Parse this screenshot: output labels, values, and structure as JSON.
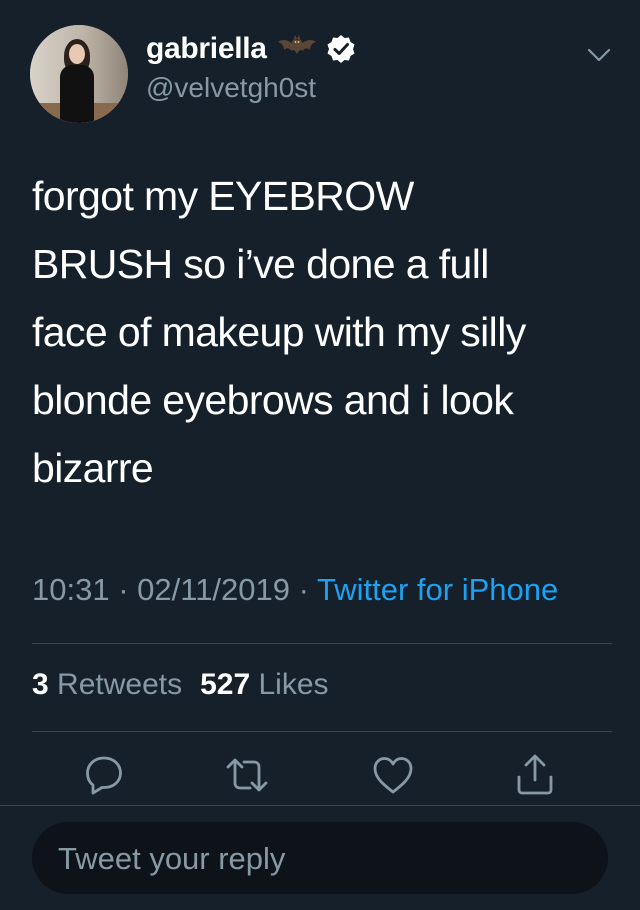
{
  "user": {
    "display_name": "gabriella",
    "handle": "@velvetgh0st",
    "name_emoji": "bat-icon",
    "verified": true
  },
  "tweet": {
    "text": "forgot my EYEBROW\nBRUSH so i’ve done a full\nface of makeup with my silly\nblonde eyebrows and i look\nbizarre",
    "time": "10:31",
    "date": "02/11/2019",
    "separator": "·",
    "source": "Twitter for iPhone"
  },
  "stats": {
    "retweets_count": "3",
    "retweets_label": "Retweets",
    "likes_count": "527",
    "likes_label": "Likes"
  },
  "actions": [
    "reply-icon",
    "retweet-icon",
    "like-icon",
    "share-icon"
  ],
  "reply": {
    "placeholder": "Tweet your reply"
  },
  "colors": {
    "background": "#15202b",
    "secondary_text": "#8899a6",
    "link": "#1da1f2",
    "divider": "#38444d"
  }
}
